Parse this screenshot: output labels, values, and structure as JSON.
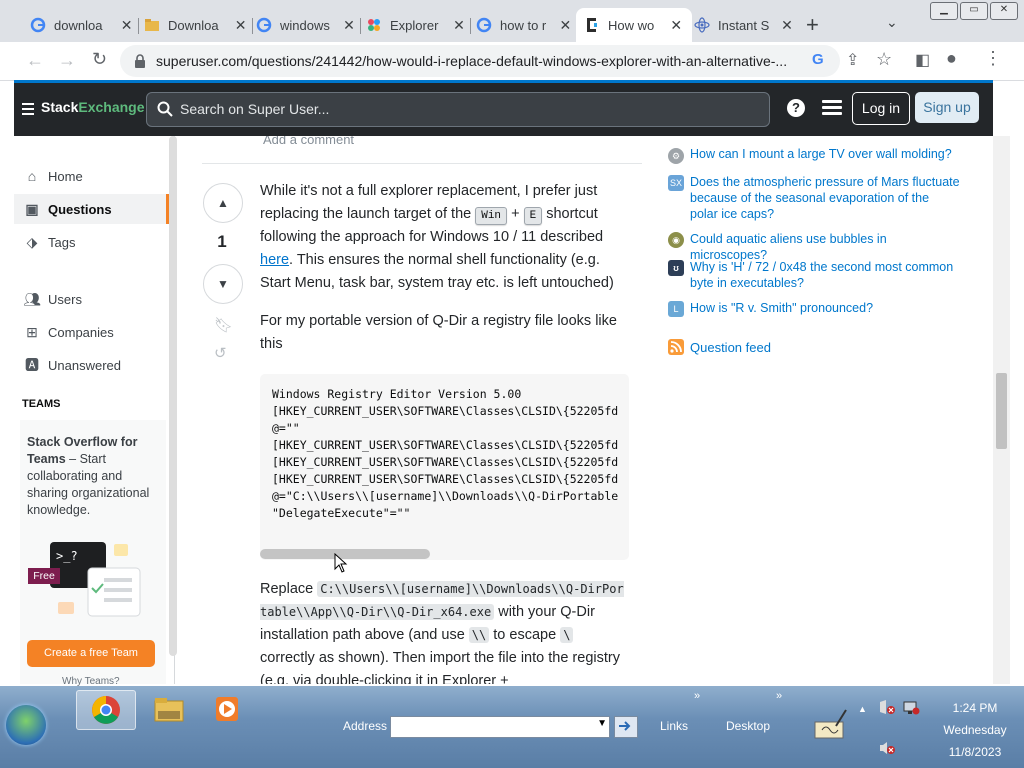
{
  "browser": {
    "tabs": [
      {
        "label": "downloa",
        "icon": "google-icon"
      },
      {
        "label": "Downloa",
        "icon": "folder-icon"
      },
      {
        "label": "windows",
        "icon": "google-icon"
      },
      {
        "label": "Explorer",
        "icon": "pinwheel-icon"
      },
      {
        "label": "how to r",
        "icon": "google-icon"
      },
      {
        "label": "How wo",
        "icon": "superuser-icon",
        "active": true
      },
      {
        "label": "Instant S",
        "icon": "react-icon"
      }
    ],
    "url": "superuser.com/questions/241442/how-would-i-replace-default-windows-explorer-with-an-alternative-..."
  },
  "se": {
    "logo_a": "Stack",
    "logo_b": "Exchange",
    "search_placeholder": "Search on Super User...",
    "login": "Log in",
    "signup": "Sign up"
  },
  "nav": {
    "items": [
      {
        "label": "Home",
        "icon": "home-icon"
      },
      {
        "label": "Questions",
        "icon": "questions-icon",
        "active": true
      },
      {
        "label": "Tags",
        "icon": "tag-icon"
      },
      {
        "label": "Users",
        "icon": "users-icon"
      },
      {
        "label": "Companies",
        "icon": "companies-icon"
      },
      {
        "label": "Unanswered",
        "icon": "unanswered-icon"
      }
    ],
    "teams_heading": "TEAMS",
    "teams_title_bold": "Stack Overflow for Teams",
    "teams_title_rest": " – Start collaborating and sharing organizational knowledge.",
    "teams_badge": "Free",
    "teams_cta": "Create a free Team",
    "teams_why": "Why Teams?"
  },
  "answer": {
    "add_comment": "Add a comment",
    "votes": "1",
    "p1_a": "While it's not a full explorer replacement, I prefer just replacing the launch target of the ",
    "kbd_win": "Win",
    "plus": " + ",
    "kbd_e": "E",
    "p1_b": " shortcut following the approach for Windows 10 / 11 described ",
    "p1_link": "here",
    "p1_c": ". This ensures the normal shell functionality (e.g. Start Menu, task bar, system tray etc. is left untouched)",
    "p2": "For my portable version of Q-Dir a registry file looks like this",
    "code_lines": [
      "Windows Registry Editor Version 5.00",
      "[HKEY_CURRENT_USER\\SOFTWARE\\Classes\\CLSID\\{52205fd",
      "@=\"\"",
      "[HKEY_CURRENT_USER\\SOFTWARE\\Classes\\CLSID\\{52205fd",
      "[HKEY_CURRENT_USER\\SOFTWARE\\Classes\\CLSID\\{52205fd",
      "[HKEY_CURRENT_USER\\SOFTWARE\\Classes\\CLSID\\{52205fd",
      "@=\"C:\\\\Users\\\\[username]\\\\Downloads\\\\Q-DirPortable",
      "\"DelegateExecute\"=\"\""
    ],
    "p3_a": "Replace ",
    "p3_code1": "C:\\\\Users\\\\[username]\\\\Downloads\\\\Q-DirPortable\\\\App\\\\Q-Dir\\\\Q-Dir_x64.exe",
    "p3_b": " with your Q-Dir installation path above (and use ",
    "p3_code2": "\\\\",
    "p3_c": " to escape ",
    "p3_code3": "\\",
    "p3_d": " correctly as shown). Then import the file into the registry (e.g. via double-clicking it in Explorer + "
  },
  "hot": [
    {
      "title": "How can I mount a large TV over wall molding?",
      "icon": "diy-icon",
      "color": "#9ea4a9"
    },
    {
      "title": "Does the atmospheric pressure of Mars fluctuate because of the seasonal evaporation of the polar ice caps?",
      "icon": "space-icon",
      "color": "#6aa4d8"
    },
    {
      "title": "Could aquatic aliens use bubbles in microscopes?",
      "icon": "worldbuilding-icon",
      "color": "#8c8f4a"
    },
    {
      "title": "Why is 'H' / 72 / 0x48 the second most common byte in executables?",
      "icon": "retrocomputing-icon",
      "color": "#2d3e57"
    },
    {
      "title": "How is \"R v. Smith\" pronounced?",
      "icon": "law-icon",
      "color": "#6aa8d6"
    }
  ],
  "feed": "Question feed",
  "taskbar": {
    "address_label": "Address",
    "links": "Links",
    "desktop": "Desktop",
    "time": "1:24 PM",
    "day": "Wednesday",
    "date": "11/8/2023"
  }
}
